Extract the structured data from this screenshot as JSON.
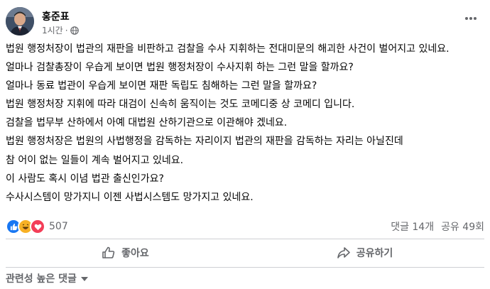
{
  "post": {
    "author": "홍준표",
    "time": "1시간",
    "separator": "·",
    "paragraphs": [
      "법원 행정처장이 법관의 재판을 비판하고 검찰을 수사 지휘하는 전대미문의 해괴한 사건이 벌어지고 있네요.",
      "얼마나 검찰총장이 우습게 보이면 법원 행정처장이 수사지휘 하는 그런 말을 할까요?",
      "얼마나 동료 법관이 우습게 보이면 재판 독립도 침해하는 그런 말을 할까요?",
      "법원 행정처장 지휘에 따라 대검이 신속히 움직이는 것도 코메디중 상 코메디 입니다.",
      "검찰을 법무부 산하에서 아예 대법원 산하기관으로 이관해야 겠네요.",
      "법원 행정처장은 법원의 사법행정을 감독하는 자리이지 법관의 재판을 감독하는 자리는 아닐진데",
      "참 어이 없는 일들이 계속 벌어지고 있네요.",
      "이 사람도 혹시 이념 법관 출신인가요?",
      "수사시스템이 망가지니 이젠 사법시스템도 망가지고 있네요."
    ]
  },
  "stats": {
    "reaction_count": "507",
    "comments": "댓글 14개",
    "shares": "공유 49회",
    "reaction_icons": [
      "like-icon",
      "haha-icon",
      "love-icon"
    ]
  },
  "actions": {
    "like": "좋아요",
    "share": "공유하기"
  },
  "comments_sort": {
    "label": "관련성 높은 댓글"
  },
  "colors": {
    "like_blue": "#1877f2",
    "haha_yellow": "#f7b125",
    "love_red": "#f33e58",
    "secondary_text": "#65676b",
    "divider": "#ced0d4"
  }
}
